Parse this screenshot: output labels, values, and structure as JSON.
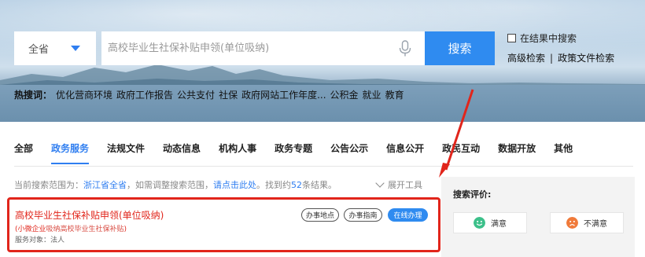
{
  "search": {
    "scope": "全省",
    "placeholder": "高校毕业生社保补贴申领(单位吸纳)",
    "button": "搜索",
    "in_result": "在结果中搜索",
    "advanced": "高级检索",
    "separator": "|",
    "policy": "政策文件检索"
  },
  "hot": {
    "label": "热搜词：",
    "words": [
      "优化营商环境",
      "政府工作报告",
      "公共支付",
      "社保",
      "政府网站工作年度...",
      "公积金",
      "就业",
      "教育"
    ]
  },
  "tabs": [
    {
      "label": "全部"
    },
    {
      "label": "政务服务",
      "active": true
    },
    {
      "label": "法规文件"
    },
    {
      "label": "动态信息"
    },
    {
      "label": "机构人事"
    },
    {
      "label": "政务专题"
    },
    {
      "label": "公告公示"
    },
    {
      "label": "信息公开"
    },
    {
      "label": "政民互动"
    },
    {
      "label": "数据开放"
    },
    {
      "label": "其他"
    }
  ],
  "scope_row": {
    "prefix": "当前搜索范围为：",
    "scope": "浙江省全省",
    "mid": "，如需调整搜索范围，",
    "link": "请点击此处",
    "suffix1": "。找到约",
    "count": "52",
    "suffix2": "条结果。",
    "expand": "展开工具"
  },
  "result": {
    "title": "高校毕业生社保补贴申领(单位吸纳)",
    "sub_prefix": "(小微企业",
    "sub_text": "吸纳高校毕业生社保补贴",
    "sub_suffix": ")",
    "target": "服务对象：法人",
    "chips": [
      "办事地点",
      "办事指南",
      "在线办理"
    ]
  },
  "evaluation": {
    "title": "搜索评价:",
    "satisfied": "满意",
    "unsatisfied": "不满意"
  },
  "colors": {
    "accent": "#2f8bf0",
    "highlight": "#e1251b",
    "satisfied_face": "#3cc08a",
    "unsatisfied_face": "#f07a3a"
  },
  "icons": {
    "select": "caret-down-icon",
    "voice": "microphone-icon",
    "expand": "chevron-down-icon",
    "satisfied": "smile-face-icon",
    "unsatisfied": "frown-face-icon"
  }
}
